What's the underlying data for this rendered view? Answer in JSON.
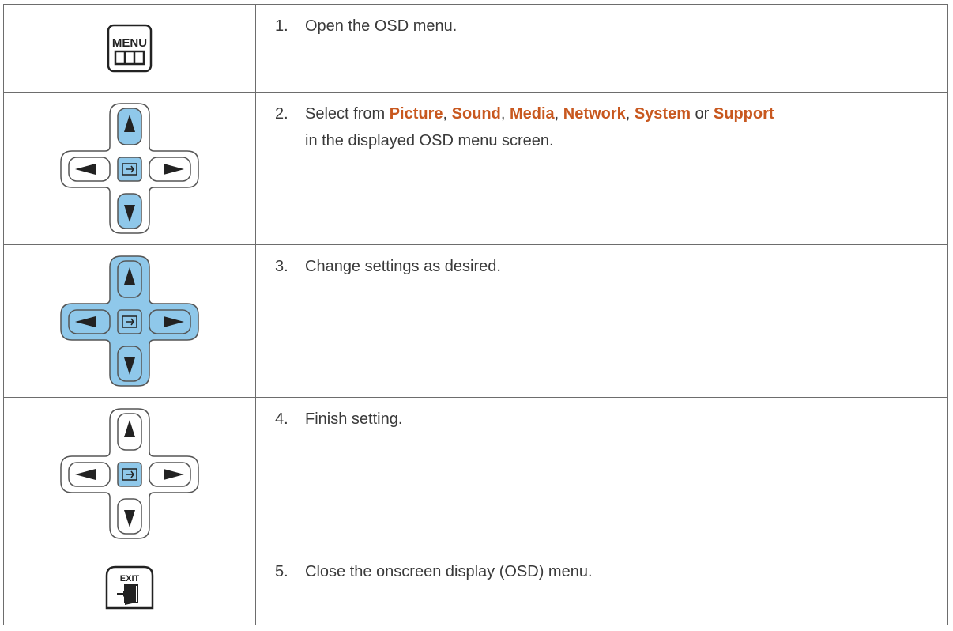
{
  "steps": [
    {
      "number": "1.",
      "text": "Open the OSD menu.",
      "button": "menu-button",
      "button_label": "MENU"
    },
    {
      "number": "2.",
      "before": "Select from ",
      "items": [
        "Picture",
        "Sound",
        "Media",
        "Network",
        "System",
        "Support"
      ],
      "sep": ", ",
      "or": " or ",
      "after": "in the displayed OSD menu screen.",
      "button": "dpad-center-up-down"
    },
    {
      "number": "3.",
      "text": "Change settings as desired.",
      "button": "dpad-all"
    },
    {
      "number": "4.",
      "text": "Finish setting.",
      "button": "dpad-center"
    },
    {
      "number": "5.",
      "text": "Close the onscreen display (OSD) menu.",
      "button": "exit-button",
      "button_label": "EXIT"
    }
  ],
  "colors": {
    "highlight_text": "#c8581f",
    "key_active": "#8fc8ea",
    "key_inactive": "#ffffff",
    "border": "#6d6d6d"
  }
}
